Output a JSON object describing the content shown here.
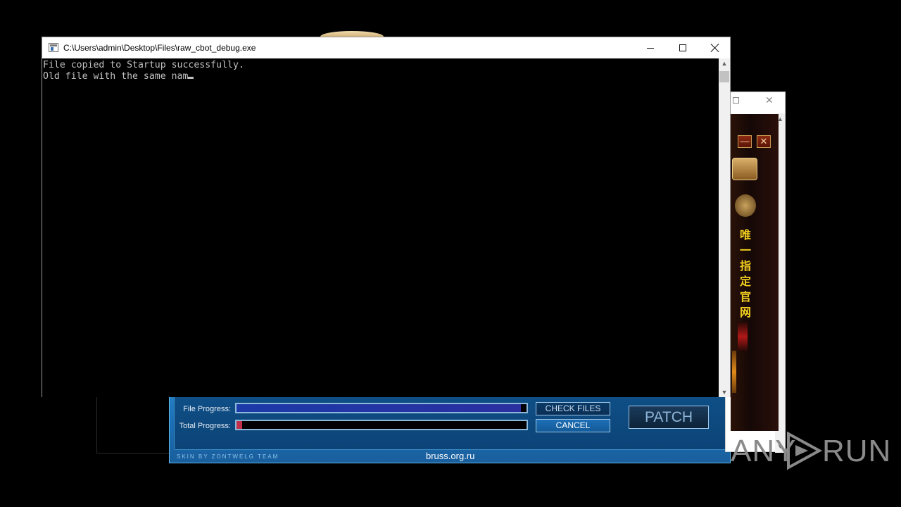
{
  "console": {
    "title": "C:\\Users\\admin\\Desktop\\Files\\raw_cbot_debug.exe",
    "lines": [
      "File copied to Startup successfully.",
      "Old file with the same nam"
    ]
  },
  "patcher": {
    "file_progress_label": "File Progress:",
    "total_progress_label": "Total Progress:",
    "file_progress": 0.98,
    "total_progress": 0.02,
    "check_files_label": "CHECK FILES",
    "cancel_label": "CANCEL",
    "patch_label": "PATCH",
    "skin_credit": "SKIN BY ZONTWELG TEAM",
    "site": "bruss.org.ru",
    "colors": {
      "file_fill": "#2b2fa0",
      "total_fill": "#c0304a"
    }
  },
  "game_window": {
    "vertical_text": [
      "唯",
      "一",
      "指",
      "定",
      "官",
      "网"
    ]
  },
  "watermark": {
    "left": "ANY",
    "right": "RUN"
  }
}
